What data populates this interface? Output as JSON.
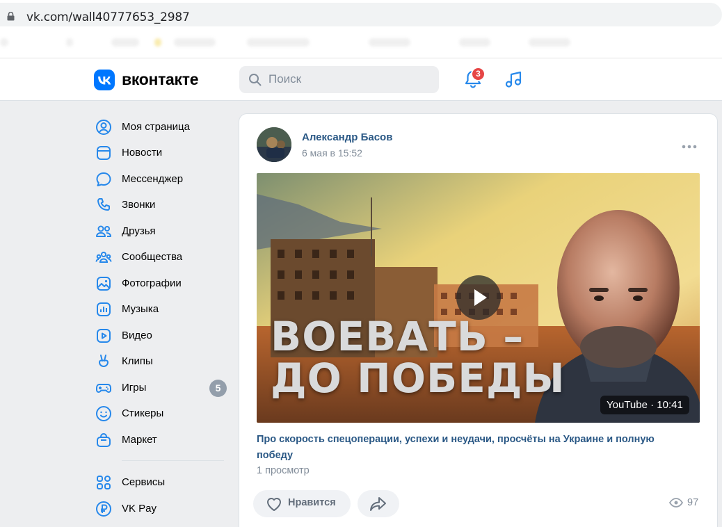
{
  "browser": {
    "url": "vk.com/wall40777653_2987"
  },
  "header": {
    "logo_text": "вконтакте",
    "search_placeholder": "Поиск",
    "notifications_count": "3"
  },
  "sidebar": {
    "items": [
      {
        "label": "Моя страница",
        "icon": "user-circle-icon"
      },
      {
        "label": "Новости",
        "icon": "news-icon"
      },
      {
        "label": "Мессенджер",
        "icon": "message-icon"
      },
      {
        "label": "Звонки",
        "icon": "phone-icon"
      },
      {
        "label": "Друзья",
        "icon": "friends-icon"
      },
      {
        "label": "Сообщества",
        "icon": "communities-icon"
      },
      {
        "label": "Фотографии",
        "icon": "photo-icon"
      },
      {
        "label": "Музыка",
        "icon": "music-icon"
      },
      {
        "label": "Видео",
        "icon": "video-icon"
      },
      {
        "label": "Клипы",
        "icon": "clips-icon"
      },
      {
        "label": "Игры",
        "icon": "games-icon",
        "badge": "5"
      },
      {
        "label": "Стикеры",
        "icon": "smile-icon"
      },
      {
        "label": "Маркет",
        "icon": "market-icon"
      }
    ],
    "extra_items": [
      {
        "label": "Сервисы",
        "icon": "services-icon"
      },
      {
        "label": "VK Pay",
        "icon": "vkpay-icon"
      }
    ]
  },
  "post": {
    "author": "Александр Басов",
    "date": "6 мая в 15:52",
    "video": {
      "headline_line1": "ВОЕВАТЬ –",
      "headline_line2": "ДО ПОБЕДЫ",
      "badge": "YouTube · 10:41"
    },
    "caption": "Про скорость спецоперации, успехи и неудачи, просчёты на Украине и полную победу",
    "views_text": "1 просмотр",
    "like_label": "Нравится",
    "view_count": "97"
  },
  "colors": {
    "accent": "#0077ff",
    "link": "#2a5885",
    "muted": "#818c99",
    "page_bg": "#edeef0",
    "badge_red": "#e64646"
  }
}
